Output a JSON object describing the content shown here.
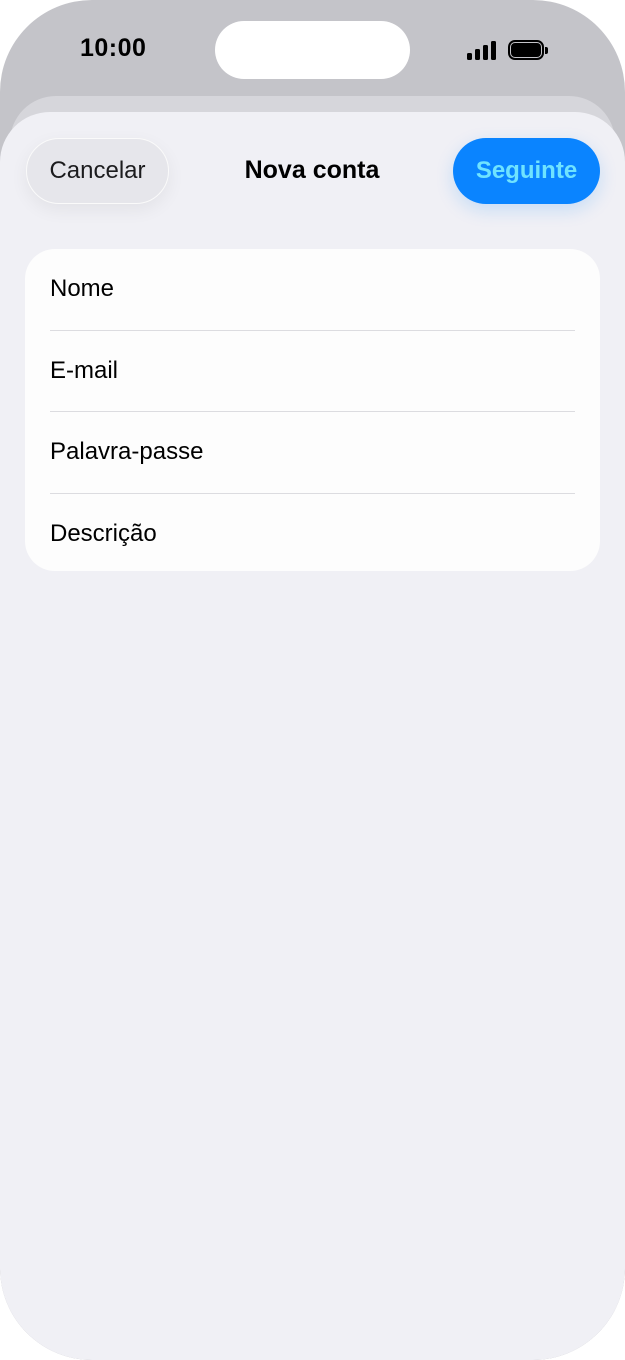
{
  "status_bar": {
    "time": "10:00",
    "signal_icon": "cellular-signal-icon",
    "battery_icon": "battery-icon"
  },
  "nav": {
    "cancel_label": "Cancelar",
    "title": "Nova conta",
    "next_label": "Seguinte"
  },
  "form": {
    "fields": [
      {
        "placeholder": "Nome",
        "value": ""
      },
      {
        "placeholder": "E-mail",
        "value": ""
      },
      {
        "placeholder": "Palavra-passe",
        "value": ""
      },
      {
        "placeholder": "Descrição",
        "value": ""
      }
    ]
  },
  "colors": {
    "accent": "#0a84ff",
    "accent_text": "#6fe3ff",
    "background": "#f0f0f5"
  }
}
